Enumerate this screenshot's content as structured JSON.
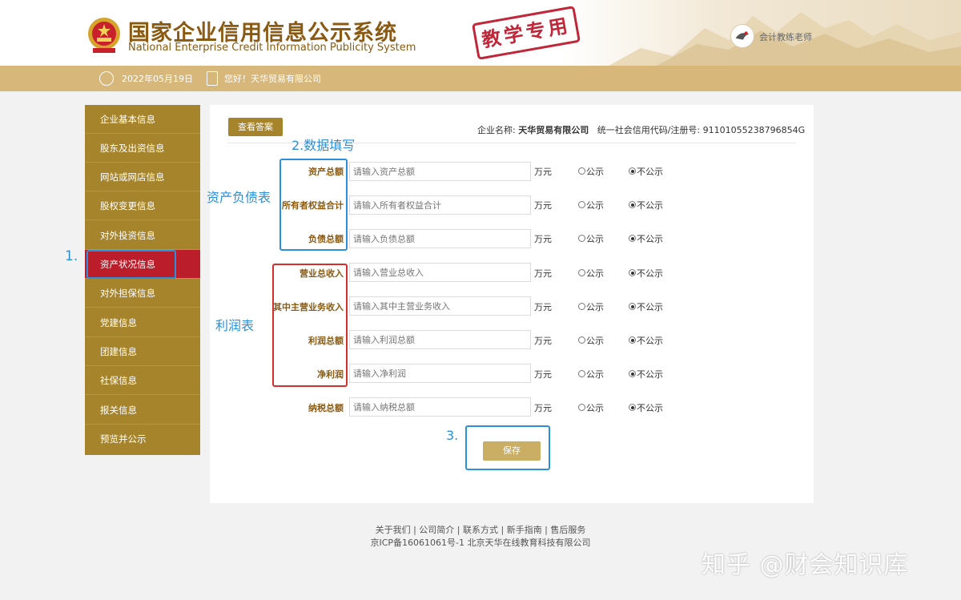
{
  "header": {
    "title_cn": "国家企业信用信息公示系统",
    "title_en": "National Enterprise Credit Information Publicity System",
    "stamp": "教学专用",
    "user_name": "会计教练老师",
    "emblem_icon": "national-emblem-icon"
  },
  "infobar": {
    "date": "2022年05月19日",
    "greeting": "您好！天华贸易有限公司"
  },
  "sidebar": {
    "items": [
      {
        "label": "企业基本信息",
        "active": false
      },
      {
        "label": "股东及出资信息",
        "active": false
      },
      {
        "label": "网站或网店信息",
        "active": false
      },
      {
        "label": "股权变更信息",
        "active": false
      },
      {
        "label": "对外投资信息",
        "active": false
      },
      {
        "label": "资产状况信息",
        "active": true
      },
      {
        "label": "对外担保信息",
        "active": false
      },
      {
        "label": "党建信息",
        "active": false
      },
      {
        "label": "团建信息",
        "active": false
      },
      {
        "label": "社保信息",
        "active": false
      },
      {
        "label": "报关信息",
        "active": false
      },
      {
        "label": "预览并公示",
        "active": false
      }
    ]
  },
  "main": {
    "answer_button": "查看答案",
    "company_label": "企业名称:",
    "company_name": "天华贸易有限公司",
    "credit_code_label": "统一社会信用代码/注册号:",
    "credit_code": "91101055238796854G",
    "unit": "万元",
    "public_label": "公示",
    "private_label": "不公示",
    "rows": [
      {
        "label": "资产总额",
        "placeholder": "请输入资产总额",
        "selected": "不公示"
      },
      {
        "label": "所有者权益合计",
        "placeholder": "请输入所有者权益合计",
        "selected": "不公示"
      },
      {
        "label": "负债总额",
        "placeholder": "请输入负债总额",
        "selected": "不公示"
      },
      {
        "label": "营业总收入",
        "placeholder": "请输入营业总收入",
        "selected": "不公示"
      },
      {
        "label": "其中主营业务收入",
        "placeholder": "请输入其中主营业务收入",
        "selected": "不公示"
      },
      {
        "label": "利润总额",
        "placeholder": "请输入利润总额",
        "selected": "不公示"
      },
      {
        "label": "净利润",
        "placeholder": "请输入净利润",
        "selected": "不公示"
      },
      {
        "label": "纳税总额",
        "placeholder": "请输入纳税总额",
        "selected": "不公示"
      }
    ],
    "save_button": "保存"
  },
  "annotations": {
    "step1": "1.",
    "step2": "2.数据填写",
    "step3": "3.",
    "balance_sheet": "资产负债表",
    "income_statement": "利润表"
  },
  "footer": {
    "links": "关于我们 | 公司简介 | 联系方式 | 新手指南 | 售后服务",
    "icp": "京ICP备16061061号-1 北京天华在线教育科技有限公司"
  },
  "watermark": "知乎 @财会知识库",
  "colors": {
    "accent_gold": "#a5842c",
    "active_red": "#bb1d2a",
    "annotation_blue": "#2b90d9",
    "annotation_red": "#d22f2f"
  }
}
